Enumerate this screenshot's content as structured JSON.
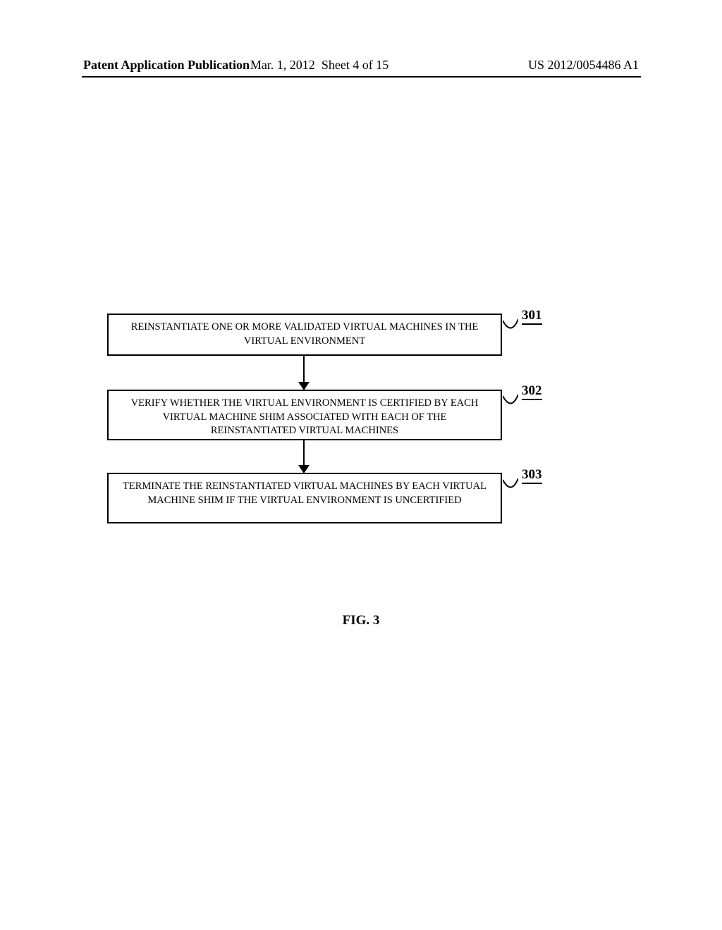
{
  "header": {
    "left": "Patent Application Publication",
    "date": "Mar. 1, 2012",
    "sheet": "Sheet 4 of 15",
    "pubnum": "US 2012/0054486 A1"
  },
  "chart_data": {
    "type": "flowchart",
    "steps": [
      {
        "ref": "301",
        "text": "REINSTANTIATE ONE OR MORE VALIDATED VIRTUAL MACHINES IN THE VIRTUAL ENVIRONMENT"
      },
      {
        "ref": "302",
        "text": "VERIFY WHETHER THE VIRTUAL ENVIRONMENT IS CERTIFIED BY EACH VIRTUAL MACHINE SHIM ASSOCIATED WITH EACH OF THE REINSTANTIATED VIRTUAL MACHINES"
      },
      {
        "ref": "303",
        "text": "TERMINATE THE REINSTANTIATED VIRTUAL MACHINES BY EACH VIRTUAL MACHINE SHIM IF THE VIRTUAL ENVIRONMENT IS UNCERTIFIED"
      }
    ],
    "caption": "FIG. 3"
  }
}
